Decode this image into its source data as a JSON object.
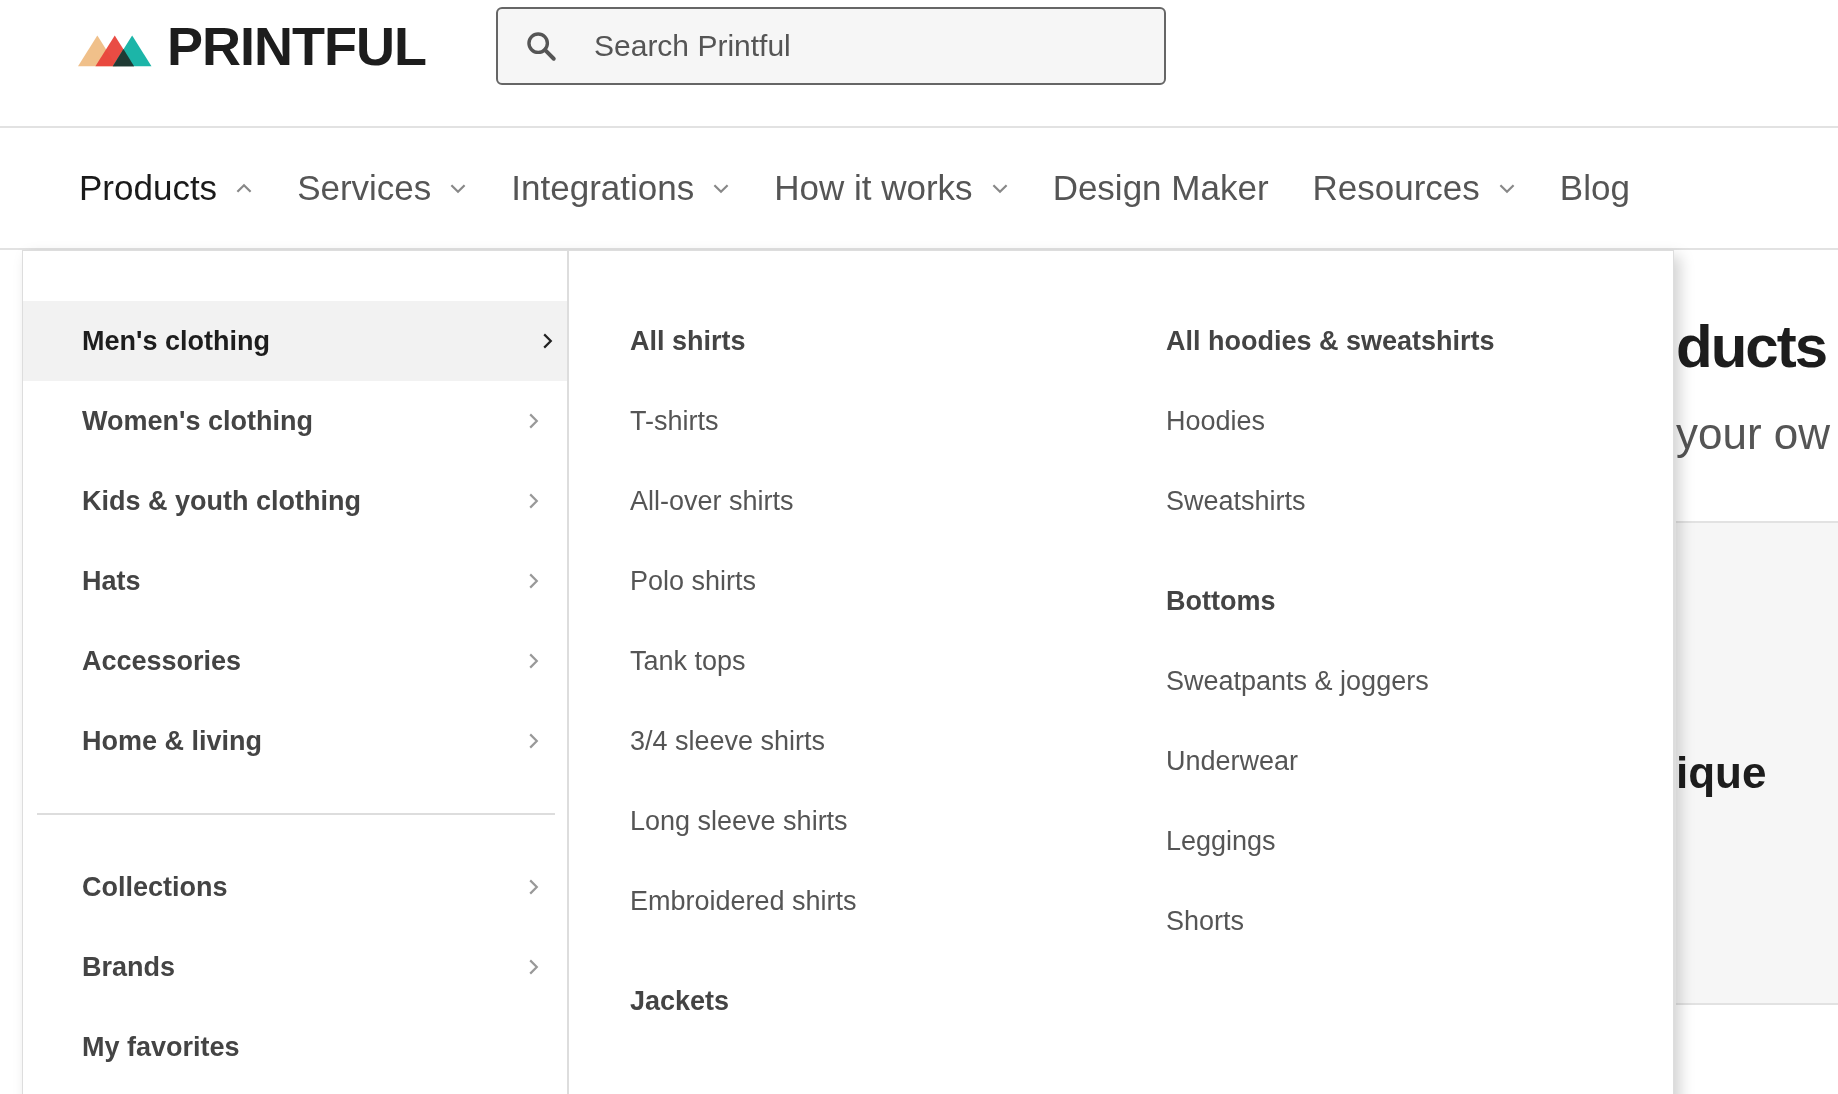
{
  "header": {
    "logo": "PRINTFUL",
    "search": {
      "placeholder": "Search Printful"
    }
  },
  "nav": [
    {
      "label": "Products",
      "has_menu": true,
      "expanded": true
    },
    {
      "label": "Services",
      "has_menu": true,
      "expanded": false
    },
    {
      "label": "Integrations",
      "has_menu": true,
      "expanded": false
    },
    {
      "label": "How it works",
      "has_menu": true,
      "expanded": false
    },
    {
      "label": "Design Maker",
      "has_menu": false,
      "expanded": false
    },
    {
      "label": "Resources",
      "has_menu": true,
      "expanded": false
    },
    {
      "label": "Blog",
      "has_menu": false,
      "expanded": false
    }
  ],
  "menu": {
    "categories": [
      {
        "label": "Men's clothing",
        "selected": true,
        "has_submenu": true
      },
      {
        "label": "Women's clothing",
        "selected": false,
        "has_submenu": true
      },
      {
        "label": "Kids & youth clothing",
        "selected": false,
        "has_submenu": true
      },
      {
        "label": "Hats",
        "selected": false,
        "has_submenu": true
      },
      {
        "label": "Accessories",
        "selected": false,
        "has_submenu": true
      },
      {
        "label": "Home & living",
        "selected": false,
        "has_submenu": true
      }
    ],
    "more_categories": [
      {
        "label": "Collections",
        "selected": false,
        "has_submenu": true
      },
      {
        "label": "Brands",
        "selected": false,
        "has_submenu": true
      },
      {
        "label": "My favorites",
        "selected": false,
        "has_submenu": false
      }
    ],
    "columns": [
      [
        {
          "kind": "heading",
          "label": "All shirts"
        },
        {
          "kind": "link",
          "label": "T-shirts"
        },
        {
          "kind": "link",
          "label": "All-over shirts"
        },
        {
          "kind": "link",
          "label": "Polo shirts"
        },
        {
          "kind": "link",
          "label": "Tank tops"
        },
        {
          "kind": "link",
          "label": "3/4 sleeve shirts"
        },
        {
          "kind": "link",
          "label": "Long sleeve shirts"
        },
        {
          "kind": "link",
          "label": "Embroidered shirts"
        },
        {
          "kind": "heading",
          "label": "Jackets"
        }
      ],
      [
        {
          "kind": "heading",
          "label": "All hoodies & sweatshirts"
        },
        {
          "kind": "link",
          "label": "Hoodies"
        },
        {
          "kind": "link",
          "label": "Sweatshirts"
        },
        {
          "kind": "heading",
          "label": "Bottoms"
        },
        {
          "kind": "link",
          "label": "Sweatpants & joggers"
        },
        {
          "kind": "link",
          "label": "Underwear"
        },
        {
          "kind": "link",
          "label": "Leggings"
        },
        {
          "kind": "link",
          "label": "Shorts"
        }
      ]
    ]
  },
  "background_page": {
    "heading": "ducts",
    "subtitle": "your ow",
    "card_title": "ique"
  }
}
